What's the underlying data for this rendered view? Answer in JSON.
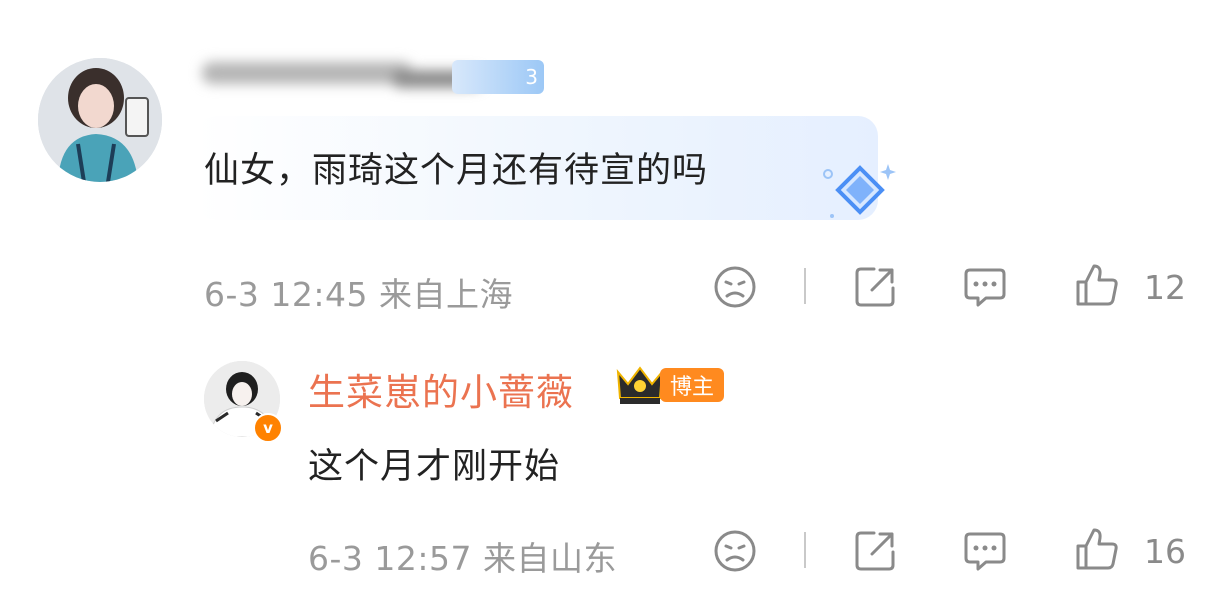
{
  "comment": {
    "level_badge": "3",
    "text": "仙女，雨琦这个月还有待宣的吗",
    "meta": "6-3 12:45 来自上海",
    "like_count": "12",
    "icons": [
      "dislike-face-icon",
      "share-icon",
      "comment-icon",
      "like-icon"
    ]
  },
  "reply": {
    "username": "生菜崽的小蔷薇",
    "badge": "博主",
    "verified_mark": "v",
    "text": "这个月才刚开始",
    "meta": "6-3 12:57 来自山东",
    "like_count": "16"
  },
  "colors": {
    "username_orange": "#eb7350",
    "host_badge": "#ff8a1f",
    "verified": "#ff8200",
    "meta_gray": "#9a9a9a"
  }
}
